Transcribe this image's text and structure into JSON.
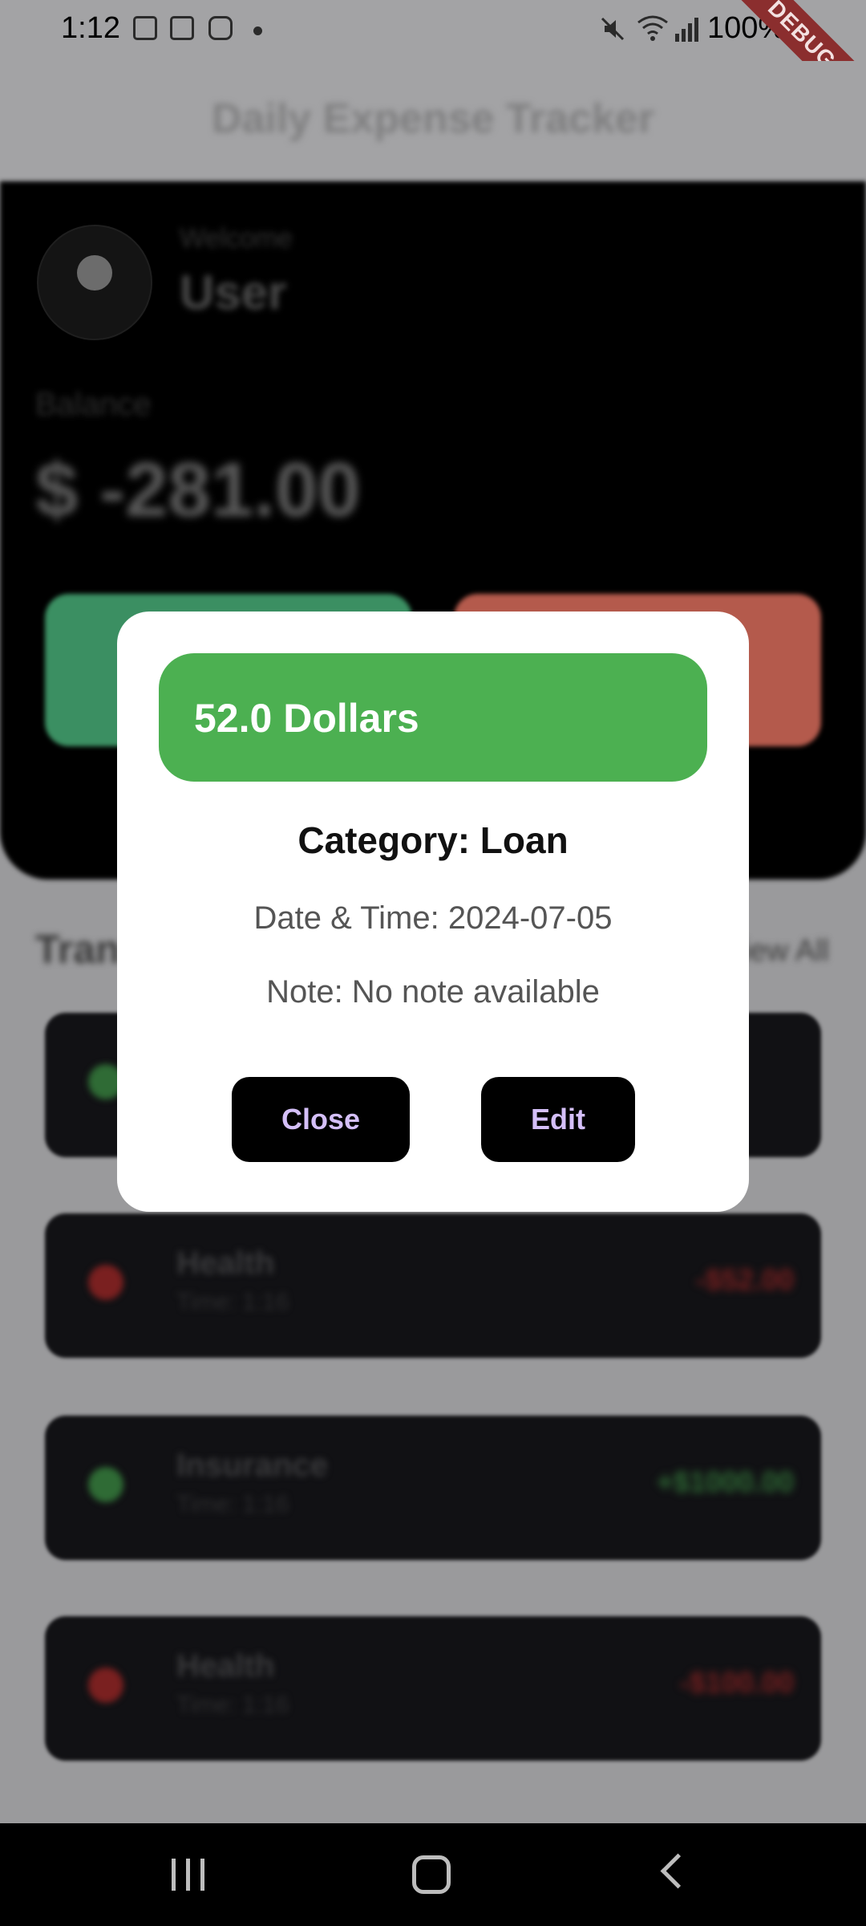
{
  "status_bar": {
    "time": "1:12",
    "battery": "100%",
    "icons": [
      "gallery-icon",
      "calendar-icon",
      "instagram-icon",
      "mute-icon",
      "wifi-icon",
      "signal-icon"
    ]
  },
  "debug_banner": "DEBUG",
  "app_bar": {
    "title": "Daily Expense Tracker"
  },
  "header": {
    "welcome": "Welcome",
    "username": "User",
    "balance_label": "Balance",
    "balance_value": "$ -281.00"
  },
  "transactions": {
    "title": "Transactions",
    "view_all": "View All",
    "items": [
      {
        "category": "",
        "time": "",
        "amount": "",
        "type": "income"
      },
      {
        "category": "Health",
        "time": "Time: 1:16",
        "amount": "-$52.00",
        "type": "expense"
      },
      {
        "category": "Insurance",
        "time": "Time: 1:16",
        "amount": "+$1000.00",
        "type": "income"
      },
      {
        "category": "Health",
        "time": "Time: 1:16",
        "amount": "-$100.00",
        "type": "expense"
      }
    ]
  },
  "dialog": {
    "amount": "52.0 Dollars",
    "category": "Category: Loan",
    "datetime": "Date & Time: 2024-07-05",
    "note": "Note: No note available",
    "close_label": "Close",
    "edit_label": "Edit"
  },
  "colors": {
    "income": "#4cb051",
    "expense": "#e53935",
    "button_text": "#d4bff8",
    "dialog_bg": "#ffffff"
  }
}
